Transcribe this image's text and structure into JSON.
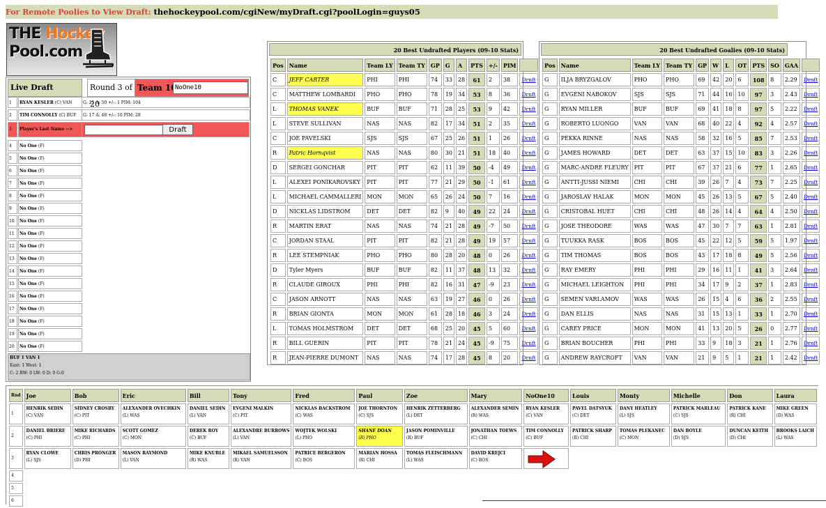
{
  "topbar": {
    "label": "For Remote Poolies to View Draft:",
    "url": "thehockeypool.com/cgiNew/myDraft.cgi?poolLogin=guys05"
  },
  "logo": {
    "line1a": "THE ",
    "line1b": "Hockey",
    "line2": "Pool.com"
  },
  "live_draft": {
    "title": "Live Draft",
    "round": "Round 3 of 20",
    "team_label": "Team 10:",
    "team_value": "NoOne10",
    "picks": [
      {
        "num": "1",
        "name": "RYAN KESLER",
        "pos": "(C) VAN",
        "stats": "G: 25 A: 50 +/-: 1 PIM: 104"
      },
      {
        "num": "2",
        "name": "TIM CONNOLLY",
        "pos": "(C) BUF",
        "stats": "G: 17 A: 48 +/-: 10 PIM: 28"
      }
    ],
    "input_num": "3",
    "input_label": "Player's Last Name -->",
    "input_placeholder": "",
    "draft_button": "Draft",
    "empty_label": "No One",
    "empty_pos": "(F)",
    "empty_nums": [
      "4",
      "5",
      "6",
      "7",
      "8",
      "9",
      "10",
      "11",
      "12",
      "13",
      "14",
      "15",
      "16",
      "17",
      "18",
      "19",
      "20"
    ],
    "summary": [
      "BUF 1 VAN 1",
      "East: 1 West: 1",
      "C: 2 RW: 0 LW: 0 D: 0 G:0"
    ]
  },
  "players": {
    "title": "20 Best Undrafted Players (09-10 Stats)",
    "headers": [
      "Pos",
      "Name",
      "Team LY",
      "Team TY",
      "GP",
      "G",
      "A",
      "PTS",
      "+/-",
      "PIM",
      ""
    ],
    "link": "Drnft",
    "rows": [
      [
        "C",
        "JEFF CARTER",
        "PHI",
        "PHI",
        "74",
        "33",
        "28",
        "61",
        "2",
        "38"
      ],
      [
        "C",
        "MATTHEW LOMBARDI",
        "PHO",
        "PHO",
        "78",
        "19",
        "34",
        "53",
        "8",
        "36"
      ],
      [
        "L",
        "THOMAS VANEK",
        "BUF",
        "BUF",
        "71",
        "28",
        "25",
        "53",
        "9",
        "42"
      ],
      [
        "L",
        "STEVE SULLIVAN",
        "NAS",
        "NAS",
        "82",
        "17",
        "34",
        "51",
        "2",
        "35"
      ],
      [
        "C",
        "JOE PAVELSKI",
        "SJS",
        "SJS",
        "67",
        "25",
        "26",
        "51",
        "1",
        "26"
      ],
      [
        "R",
        "Patric Hornqvist",
        "NAS",
        "NAS",
        "80",
        "30",
        "21",
        "51",
        "18",
        "40"
      ],
      [
        "D",
        "SERGEI GONCHAR",
        "PIT",
        "PIT",
        "62",
        "11",
        "39",
        "50",
        "-4",
        "49"
      ],
      [
        "L",
        "ALEXEI PONIKAROVSKY",
        "PIT",
        "PIT",
        "77",
        "21",
        "29",
        "50",
        "-1",
        "61"
      ],
      [
        "L",
        "MICHAEL CAMMALLERI",
        "MON",
        "MON",
        "65",
        "26",
        "24",
        "50",
        "7",
        "16"
      ],
      [
        "D",
        "NICKLAS LIDSTROM",
        "DET",
        "DET",
        "82",
        "9",
        "40",
        "49",
        "22",
        "24"
      ],
      [
        "R",
        "MARTIN ERAT",
        "NAS",
        "NAS",
        "74",
        "21",
        "28",
        "49",
        "-7",
        "50"
      ],
      [
        "C",
        "JORDAN STAAL",
        "PIT",
        "PIT",
        "82",
        "21",
        "28",
        "49",
        "19",
        "57"
      ],
      [
        "R",
        "LEE STEMPNIAK",
        "PHO",
        "PHO",
        "80",
        "28",
        "20",
        "48",
        "0",
        "26"
      ],
      [
        "D",
        "Tyler Myers",
        "BUF",
        "BUF",
        "82",
        "11",
        "37",
        "48",
        "13",
        "32"
      ],
      [
        "R",
        "CLAUDE GIROUX",
        "PHI",
        "PHI",
        "82",
        "16",
        "31",
        "47",
        "-9",
        "23"
      ],
      [
        "C",
        "JASON ARNOTT",
        "NAS",
        "NAS",
        "63",
        "19",
        "27",
        "46",
        "0",
        "26"
      ],
      [
        "R",
        "BRIAN GIONTA",
        "MON",
        "MON",
        "61",
        "28",
        "18",
        "46",
        "3",
        "24"
      ],
      [
        "L",
        "TOMAS HOLMSTROM",
        "DET",
        "DET",
        "68",
        "25",
        "20",
        "45",
        "5",
        "60"
      ],
      [
        "R",
        "BILL GUERIN",
        "PIT",
        "PIT",
        "78",
        "21",
        "24",
        "45",
        "-9",
        "75"
      ],
      [
        "R",
        "JEAN-PIERRE DUMONT",
        "NAS",
        "NAS",
        "74",
        "17",
        "28",
        "45",
        "8",
        "20"
      ]
    ],
    "highlight_rows": [
      0,
      2,
      5
    ]
  },
  "goalies": {
    "title": "20 Best Undrafted Goalies (09-10 Stats)",
    "headers": [
      "Pos",
      "Name",
      "Team LY",
      "Team TY",
      "GP",
      "W",
      "L",
      "OT",
      "PTS",
      "SO",
      "GAA",
      ""
    ],
    "link": "Drnft",
    "rows": [
      [
        "G",
        "ILJA BRYZGALOV",
        "PHO",
        "PHO",
        "69",
        "42",
        "20",
        "6",
        "108",
        "8",
        "2.29"
      ],
      [
        "G",
        "EVGENI NABOKOV",
        "SJS",
        "SJS",
        "71",
        "44",
        "16",
        "10",
        "97",
        "3",
        "2.43"
      ],
      [
        "G",
        "RYAN MILLER",
        "BUF",
        "BUF",
        "69",
        "41",
        "18",
        "8",
        "97",
        "5",
        "2.22"
      ],
      [
        "G",
        "ROBERTO LUONGO",
        "VAN",
        "VAN",
        "68",
        "40",
        "22",
        "4",
        "92",
        "4",
        "2.57"
      ],
      [
        "G",
        "PEKKA RINNE",
        "NAS",
        "NAS",
        "58",
        "32",
        "16",
        "5",
        "85",
        "7",
        "2.53"
      ],
      [
        "G",
        "JAMES HOWARD",
        "DET",
        "DET",
        "63",
        "37",
        "15",
        "10",
        "83",
        "3",
        "2.26"
      ],
      [
        "G",
        "MARC-ANDRE FLEURY",
        "PIT",
        "PIT",
        "67",
        "37",
        "21",
        "6",
        "77",
        "1",
        "2.65"
      ],
      [
        "G",
        "ANTTI-JUSSI NIEMI",
        "CHI",
        "CHI",
        "39",
        "26",
        "7",
        "4",
        "73",
        "7",
        "2.25"
      ],
      [
        "G",
        "JAROSLAV HALAK",
        "MON",
        "MON",
        "45",
        "26",
        "13",
        "5",
        "67",
        "5",
        "2.40"
      ],
      [
        "G",
        "CRISTOBAL HUET",
        "CHI",
        "CHI",
        "48",
        "26",
        "14",
        "4",
        "64",
        "4",
        "2.50"
      ],
      [
        "G",
        "JOSE THEODORE",
        "WAS",
        "WAS",
        "47",
        "30",
        "7",
        "7",
        "63",
        "1",
        "2.81"
      ],
      [
        "G",
        "TUUKKA RASK",
        "BOS",
        "BOS",
        "45",
        "22",
        "12",
        "5",
        "59",
        "5",
        "1.97"
      ],
      [
        "G",
        "TIM THOMAS",
        "BOS",
        "BOS",
        "43",
        "17",
        "18",
        "8",
        "49",
        "5",
        "2.56"
      ],
      [
        "G",
        "RAY EMERY",
        "PHI",
        "PHI",
        "29",
        "16",
        "11",
        "1",
        "41",
        "3",
        "2.64"
      ],
      [
        "G",
        "MICHAEL LEIGHTON",
        "PHI",
        "PHI",
        "34",
        "17",
        "9",
        "2",
        "37",
        "1",
        "2.83"
      ],
      [
        "G",
        "SEMEN VARLAMOV",
        "WAS",
        "WAS",
        "26",
        "15",
        "4",
        "6",
        "36",
        "2",
        "2.55"
      ],
      [
        "G",
        "DAN ELLIS",
        "NAS",
        "NAS",
        "31",
        "15",
        "13",
        "1",
        "33",
        "1",
        "2.70"
      ],
      [
        "G",
        "CAREY PRICE",
        "MON",
        "MON",
        "41",
        "13",
        "20",
        "5",
        "26",
        "0",
        "2.77"
      ],
      [
        "G",
        "BRIAN BOUCHER",
        "PHI",
        "PHI",
        "33",
        "9",
        "18",
        "3",
        "21",
        "1",
        "2.76"
      ],
      [
        "G",
        "ANDREW RAYCROFT",
        "VAN",
        "VAN",
        "21",
        "9",
        "5",
        "1",
        "21",
        "1",
        "2.42"
      ]
    ]
  },
  "board": {
    "rnd_label": "Rnd",
    "teams": [
      "Joe",
      "Bob",
      "Eric",
      "Bill",
      "Tony",
      "Fred",
      "Paul",
      "Zoe",
      "Mary",
      "NoOne10",
      "Louis",
      "Monty",
      "Michelle",
      "Don",
      "Laura"
    ],
    "rounds": [
      {
        "num": "1",
        "picks": [
          [
            "HENRIK SEDIN",
            "(C) VAN"
          ],
          [
            "SIDNEY CROSBY",
            "(C) PIT"
          ],
          [
            "ALEXANDER OVECHKIN",
            "(L) WAS"
          ],
          [
            "DANIEL SEDIN",
            "(L) VAN"
          ],
          [
            "EVGENI MALKIN",
            "(C) PIT"
          ],
          [
            "NICKLAS BACKSTROM",
            "(C) WAS"
          ],
          [
            "JOE THORNTON",
            "(C) SJS"
          ],
          [
            "HENRIK ZETTERBERG",
            "(L) DET"
          ],
          [
            "ALEXANDER SEMIN",
            "(R) WAS"
          ],
          [
            "RYAN KESLER",
            "(C) VAN"
          ],
          [
            "PAVEL DATSYUK",
            "(C) DET"
          ],
          [
            "DANY HEATLEY",
            "(L) SJS"
          ],
          [
            "PATRICK MARLEAU",
            "(C) SJS"
          ],
          [
            "PATRICK KANE",
            "(R) CHI"
          ],
          [
            "MIKE GREEN",
            "(D) WAS"
          ]
        ]
      },
      {
        "num": "2",
        "picks": [
          [
            "DANIEL BRIERE",
            "(C) PHI"
          ],
          [
            "MIKE RICHARDS",
            "(C) PHI"
          ],
          [
            "SCOTT GOMEZ",
            "(C) MON"
          ],
          [
            "DEREK ROY",
            "(C) BUF"
          ],
          [
            "ALEXANDRE BURROWS",
            "(L) VAN"
          ],
          [
            "WOJTEK WOLSKI",
            "(L) PHO"
          ],
          [
            "SHANE DOAN",
            "(R) PHO"
          ],
          [
            "JASON POMINVILLE",
            "(R) BUF"
          ],
          [
            "JONATHAN TOEWS",
            "(C) CHI"
          ],
          [
            "TIM CONNOLLY",
            "(C) BUF"
          ],
          [
            "PATRICK SHARP",
            "(R) CHI"
          ],
          [
            "TOMAS PLEKANEC",
            "(C) MON"
          ],
          [
            "DAN BOYLE",
            "(D) SJS"
          ],
          [
            "DUNCAN KEITH",
            "(D) CHI"
          ],
          [
            "BROOKS LAICH",
            "(L) WAS"
          ]
        ]
      },
      {
        "num": "3",
        "picks": [
          [
            "RYAN CLOWE",
            "(L) SJS"
          ],
          [
            "CHRIS PRONGER",
            "(D) PHI"
          ],
          [
            "MASON RAYMOND",
            "(L) VAN"
          ],
          [
            "MIKE KNUBLE",
            "(R) WAS"
          ],
          [
            "MIKAEL SAMUELSSON",
            "(R) VAN"
          ],
          [
            "PATRICE BERGERON",
            "(C) BOS"
          ],
          [
            "MARIAN HOSSA",
            "(R) CHI"
          ],
          [
            "TOMAS FLEISCHMANN",
            "(L) WAS"
          ],
          [
            "DAVID KREJCI",
            "(C) BOS"
          ]
        ]
      }
    ],
    "extra_rounds": [
      "4",
      "5",
      "6"
    ],
    "current_icon": "right-arrow-icon",
    "highlight_pick": "SHANE DOAN"
  }
}
